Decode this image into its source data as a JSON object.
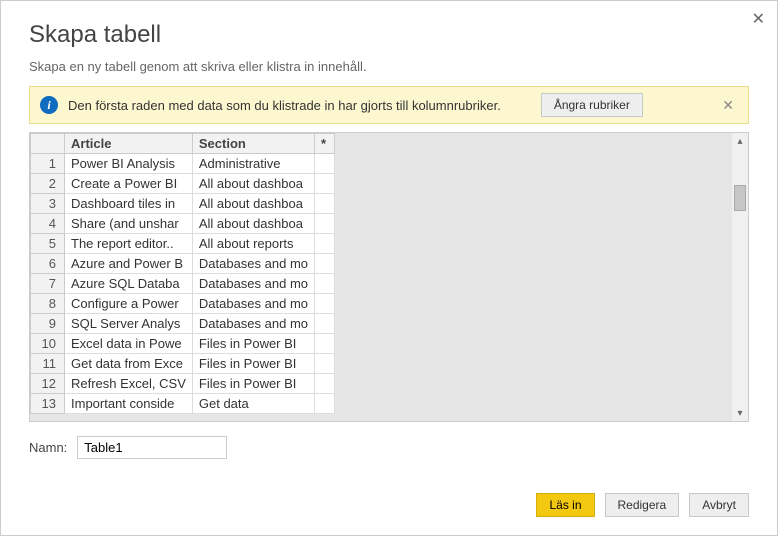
{
  "dialog": {
    "title": "Skapa tabell",
    "subtitle": "Skapa en ny tabell genom att skriva eller klistra in innehåll."
  },
  "info": {
    "message": "Den första raden med data som du klistrade in har gjorts till kolumnrubriker.",
    "undo_label": "Ångra rubriker"
  },
  "table": {
    "headers": {
      "col1": "Article",
      "col2": "Section",
      "col3": "*"
    },
    "rows": [
      {
        "n": "1",
        "article": "Power BI Analysis",
        "section": "Administrative"
      },
      {
        "n": "2",
        "article": "Create a Power BI",
        "section": "All about dashboa"
      },
      {
        "n": "3",
        "article": "Dashboard tiles in",
        "section": "All about dashboa"
      },
      {
        "n": "4",
        "article": "Share (and unshar",
        "section": "All about dashboa"
      },
      {
        "n": "5",
        "article": "The report editor..",
        "section": "All about reports"
      },
      {
        "n": "6",
        "article": "Azure and Power B",
        "section": "Databases and mo"
      },
      {
        "n": "7",
        "article": "Azure SQL Databa",
        "section": "Databases and mo"
      },
      {
        "n": "8",
        "article": "Configure a Power",
        "section": "Databases and mo"
      },
      {
        "n": "9",
        "article": "SQL Server Analys",
        "section": "Databases and mo"
      },
      {
        "n": "10",
        "article": "Excel data in Powe",
        "section": "Files in Power BI"
      },
      {
        "n": "11",
        "article": "Get data from Exce",
        "section": "Files in Power BI"
      },
      {
        "n": "12",
        "article": "Refresh Excel, CSV",
        "section": "Files in Power BI"
      },
      {
        "n": "13",
        "article": "Important conside",
        "section": "Get data"
      }
    ]
  },
  "name": {
    "label": "Namn:",
    "value": "Table1"
  },
  "footer": {
    "load": "Läs in",
    "edit": "Redigera",
    "cancel": "Avbryt"
  }
}
